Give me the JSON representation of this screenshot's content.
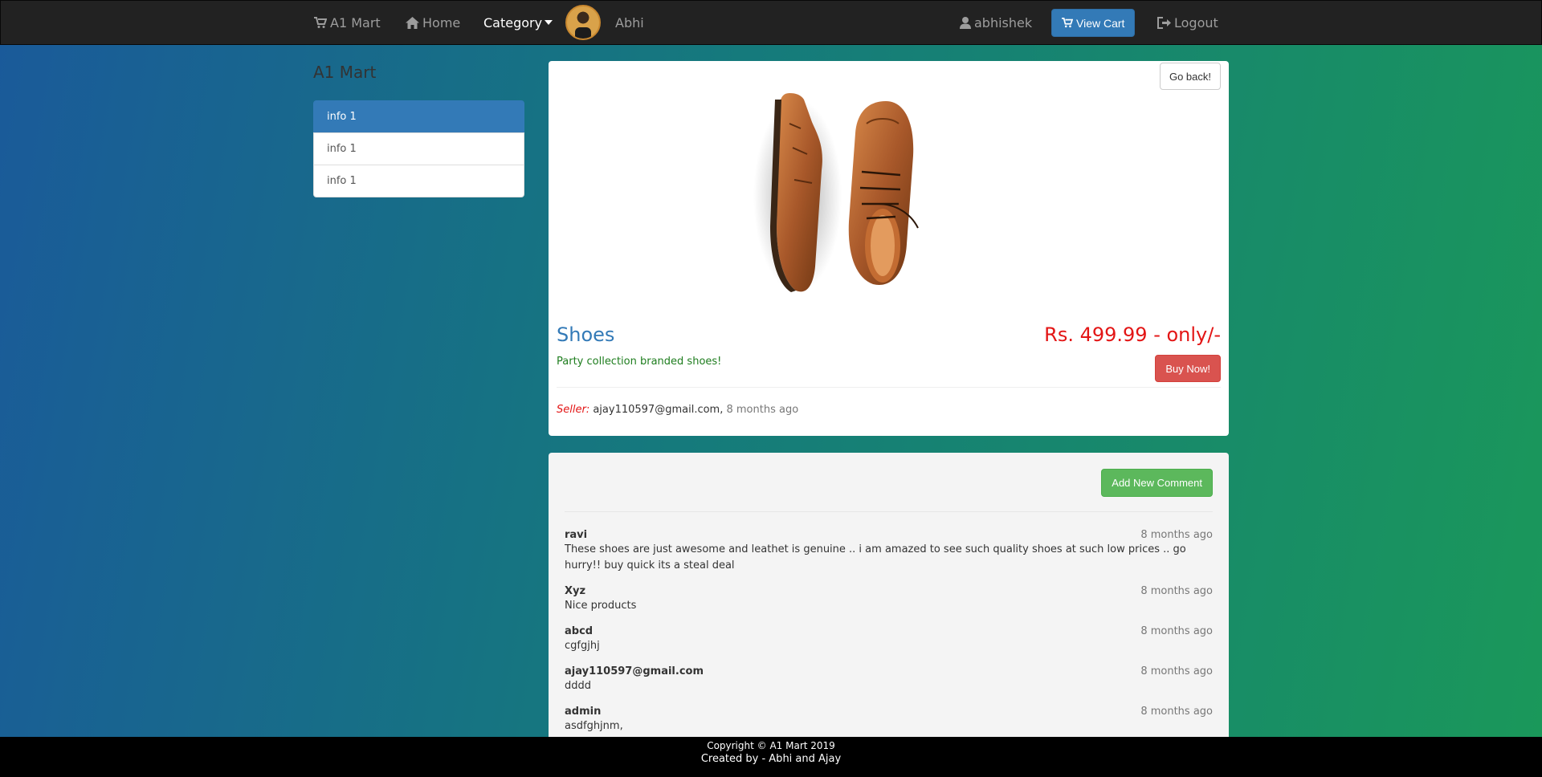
{
  "navbar": {
    "brand": "A1 Mart",
    "home": "Home",
    "category": "Category",
    "profile_name": "Abhi",
    "user": "abhishek",
    "view_cart": "View Cart",
    "logout": "Logout"
  },
  "sidebar": {
    "title": "A1 Mart",
    "items": [
      {
        "label": "info 1",
        "active": true
      },
      {
        "label": "info 1",
        "active": false
      },
      {
        "label": "info 1",
        "active": false
      }
    ]
  },
  "product": {
    "go_back": "Go back!",
    "title": "Shoes",
    "price": "Rs. 499.99 - only/-",
    "description": "Party collection branded shoes!",
    "buy_now": "Buy Now!",
    "seller_label": "Seller:",
    "seller_email": "ajay110597@gmail.com,",
    "seller_time": "8 months ago"
  },
  "comments": {
    "add_button": "Add New Comment",
    "items": [
      {
        "author": "ravi",
        "time": "8 months ago",
        "text": "These shoes are just awesome and leathet is genuine .. i am amazed to see such quality shoes at such low prices .. go hurry!! buy quick its a steal deal"
      },
      {
        "author": "Xyz",
        "time": "8 months ago",
        "text": "Nice products"
      },
      {
        "author": "abcd",
        "time": "8 months ago",
        "text": "cgfgjhj"
      },
      {
        "author": "ajay110597@gmail.com",
        "time": "8 months ago",
        "text": "dddd"
      },
      {
        "author": "admin",
        "time": "8 months ago",
        "text": "asdfghjnm,"
      }
    ]
  },
  "footer": {
    "copyright": "Copyright © A1 Mart 2019",
    "created_by": "Created by - Abhi and Ajay"
  }
}
